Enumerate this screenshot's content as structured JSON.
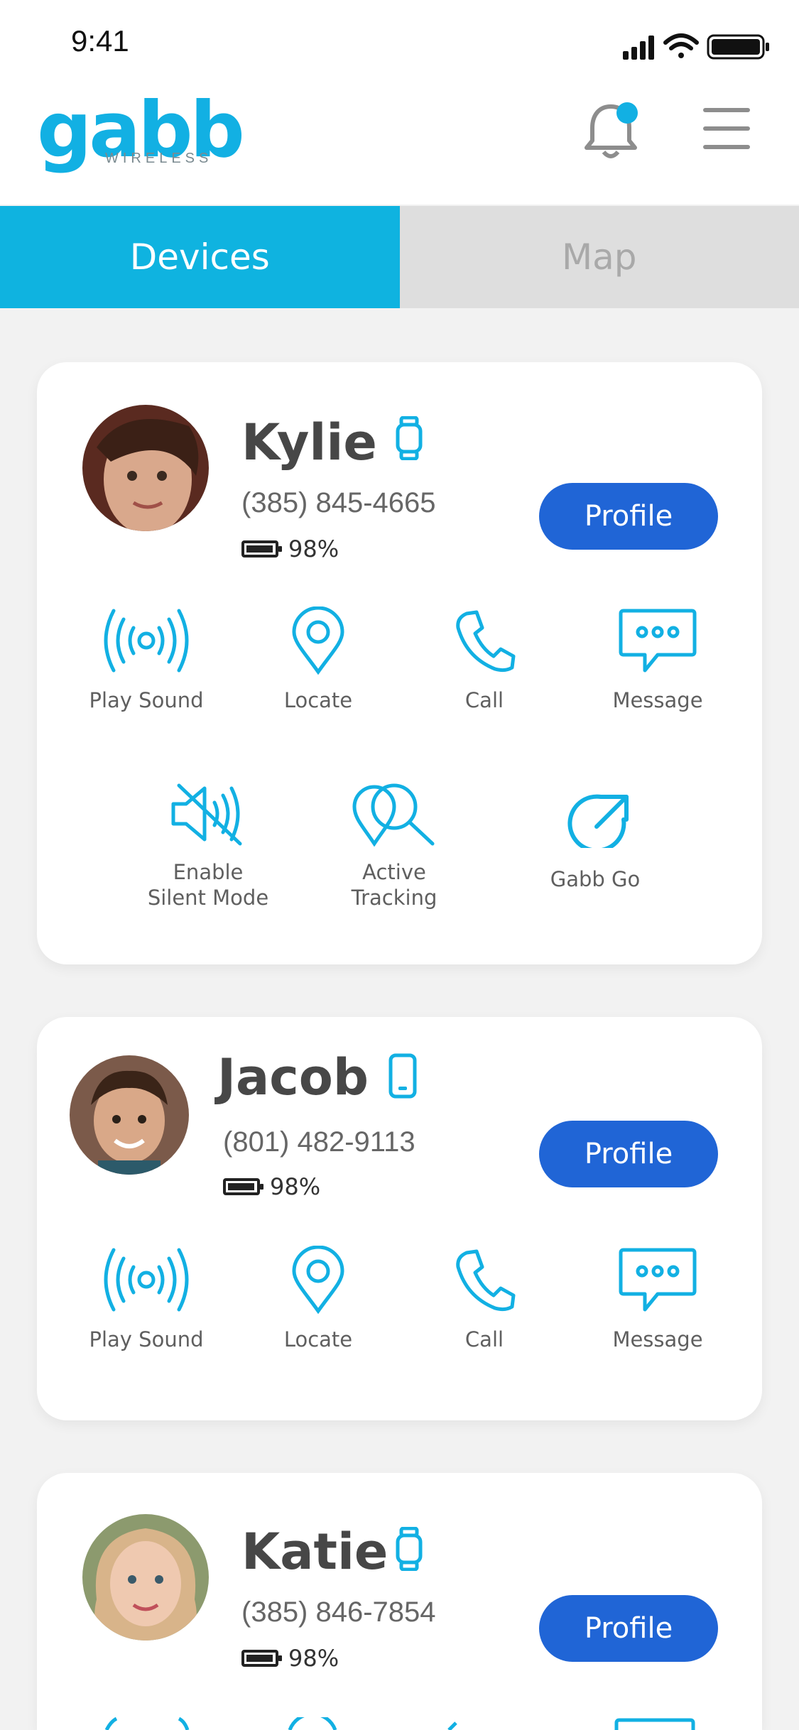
{
  "status_bar": {
    "time": "9:41"
  },
  "header": {
    "logo_text": "gabb",
    "logo_subtext": "WIRELESS",
    "notification_icon": "bell-icon",
    "menu_icon": "hamburger-menu-icon"
  },
  "tabs": [
    {
      "label": "Devices",
      "active": true
    },
    {
      "label": "Map",
      "active": false
    }
  ],
  "colors": {
    "accent": "#0fb3e0",
    "button": "#2065d6",
    "text": "#474747"
  },
  "devices": [
    {
      "name": "Kylie",
      "device_type": "watch-icon",
      "phone": "(385) 845-4665",
      "battery": "98%",
      "battery_level": 0.98,
      "profile_label": "Profile",
      "actions": [
        {
          "label": "Play Sound",
          "icon": "play-sound-icon"
        },
        {
          "label": "Locate",
          "icon": "location-pin-icon"
        },
        {
          "label": "Call",
          "icon": "phone-call-icon"
        },
        {
          "label": "Message",
          "icon": "message-icon"
        },
        {
          "label": "Enable\nSilent Mode",
          "icon": "speaker-mute-icon"
        },
        {
          "label": "Active\nTracking",
          "icon": "active-tracking-icon"
        },
        {
          "label": "Gabb Go",
          "icon": "gabb-go-icon"
        }
      ]
    },
    {
      "name": "Jacob",
      "device_type": "phone-icon",
      "phone": "(801) 482-9113",
      "battery": "98%",
      "battery_level": 0.98,
      "profile_label": "Profile",
      "actions": [
        {
          "label": "Play Sound",
          "icon": "play-sound-icon"
        },
        {
          "label": "Locate",
          "icon": "location-pin-icon"
        },
        {
          "label": "Call",
          "icon": "phone-call-icon"
        },
        {
          "label": "Message",
          "icon": "message-icon"
        }
      ]
    },
    {
      "name": "Katie",
      "device_type": "watch-icon",
      "phone": "(385) 846-7854",
      "battery": "98%",
      "battery_level": 0.98,
      "profile_label": "Profile",
      "actions": []
    }
  ]
}
